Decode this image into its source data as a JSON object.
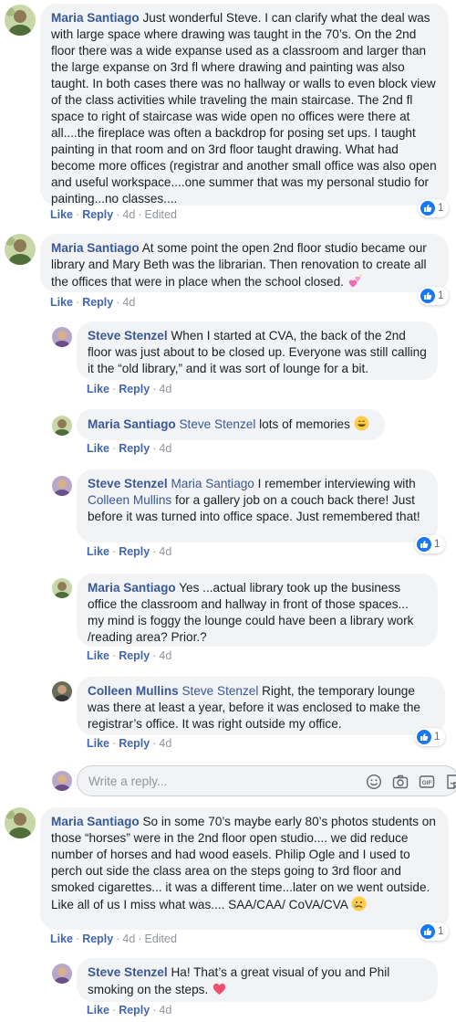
{
  "comments": [
    {
      "author": "Maria Santiago",
      "text": "Just wonderful Steve. I can clarify what the deal was with large space where drawing was taught in the 70’s. On the 2nd floor there was a wide expanse used as a classroom and larger than the large expanse on 3rd fl where drawing and painting was also taught. In both cases there was no hallway or walls to even block view of the class activities while traveling the main staircase. The 2nd fl space to right of staircase was wide open no offices were there at all....the fireplace was often a backdrop for posing set ups. I taught painting in that room and on 3rd floor taught drawing. What had become more offices (registrar and another small office was also open and useful workspace....one summer that was my personal studio for painting...no classes....",
      "like": "Like",
      "reply": "Reply",
      "time": "4d",
      "edited": "Edited",
      "reactions": "1"
    },
    {
      "author": "Maria Santiago",
      "text": "At some point the open 2nd floor studio became our library and Mary Beth was the librarian. Then renovation to create all the offices that were in place when the school closed.",
      "like": "Like",
      "reply": "Reply",
      "time": "4d",
      "reactions": "1"
    },
    {
      "author": "Steve Stenzel",
      "text": "When I started at CVA, the back of the 2nd floor was just about to be closed up. Everyone was still calling it the “old library,” and it was sort of lounge for a bit.",
      "like": "Like",
      "reply": "Reply",
      "time": "4d"
    },
    {
      "author": "Maria Santiago",
      "mention": "Steve Stenzel",
      "text": "lots of memories",
      "like": "Like",
      "reply": "Reply",
      "time": "4d"
    },
    {
      "author": "Steve Stenzel",
      "mention": "Maria Santiago",
      "text_a": "I remember interviewing with",
      "mention2": "Colleen Mullins",
      "text_b": "for a gallery job on a couch back there! Just before it was turned into office space. Just remembered that!",
      "like": "Like",
      "reply": "Reply",
      "time": "4d",
      "reactions": "1"
    },
    {
      "author": "Maria Santiago",
      "text": "Yes ...actual library took up the business office the classroom and hallway in front of those spaces... my mind is foggy the lounge could have been a library work /reading area? Prior.?",
      "like": "Like",
      "reply": "Reply",
      "time": "4d"
    },
    {
      "author": "Colleen Mullins",
      "mention": "Steve Stenzel",
      "text": "Right, the temporary lounge was there at least a year, before it was enclosed to make the registrar’s office. It was right outside my office.",
      "like": "Like",
      "reply": "Reply",
      "time": "4d",
      "reactions": "1"
    },
    {
      "author": "Maria Santiago",
      "text": "So in some 70’s maybe early 80’s photos students on those “horses” were in the 2nd floor open studio.... we did reduce number of horses and had wood easels. Philip Ogle and I used to perch out side the class area on the steps going to 3rd floor and smoked cigarettes... it was a different time...later on we went outside. Like all of us I miss what was.... SAA/CAA/ CoVA/CVA",
      "like": "Like",
      "reply": "Reply",
      "time": "4d",
      "edited": "Edited",
      "reactions": "1"
    },
    {
      "author": "Steve Stenzel",
      "text": "Ha! That’s a great visual of you and Phil smoking on the steps.",
      "like": "Like",
      "reply": "Reply",
      "time": "4d"
    }
  ],
  "reply_box": {
    "placeholder": "Write a reply..."
  },
  "icons": {
    "like": "thumbs-up-icon",
    "heart": "heart-icon",
    "grin": "grin-emoji-icon",
    "sparkle_hearts": "sparkling-hearts-icon",
    "tear": "crying-emoji-icon",
    "smile": "smile-icon",
    "camera": "camera-icon",
    "gif": "gif-icon",
    "sticker": "sticker-icon"
  },
  "colors": {
    "name": "#385898",
    "link": "#4267b2",
    "bubble": "#f2f3f5",
    "like_blue": "#1877f2",
    "meta": "#90949c"
  }
}
